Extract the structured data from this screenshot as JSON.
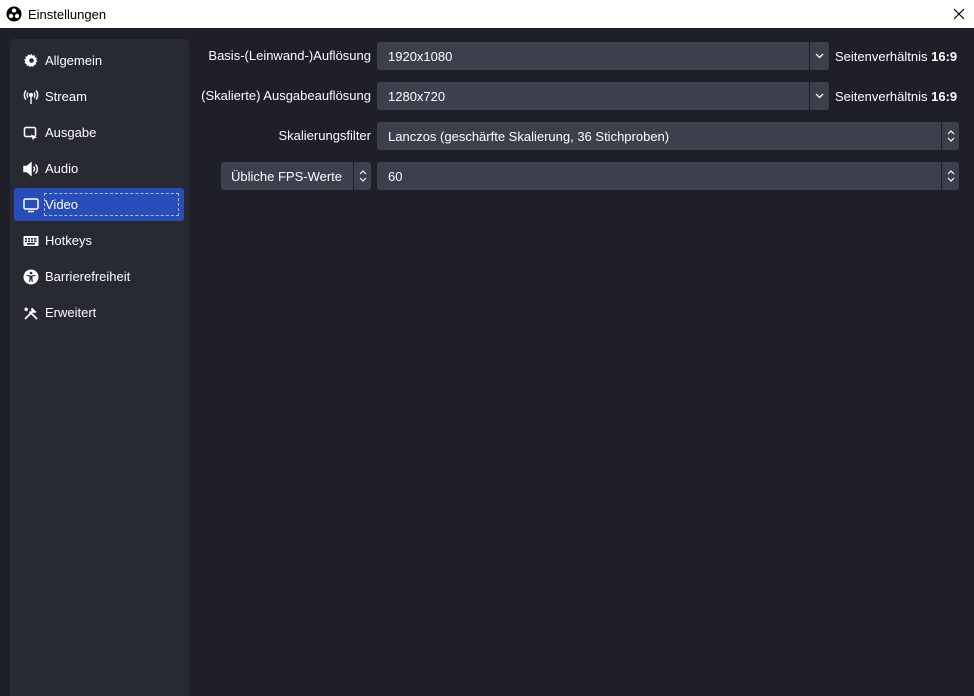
{
  "window": {
    "title": "Einstellungen"
  },
  "sidebar": {
    "items": [
      {
        "label": "Allgemein",
        "icon": "gear-icon"
      },
      {
        "label": "Stream",
        "icon": "antenna-icon"
      },
      {
        "label": "Ausgabe",
        "icon": "output-icon"
      },
      {
        "label": "Audio",
        "icon": "speaker-icon"
      },
      {
        "label": "Video",
        "icon": "monitor-icon",
        "active": true
      },
      {
        "label": "Hotkeys",
        "icon": "keyboard-icon"
      },
      {
        "label": "Barrierefreiheit",
        "icon": "accessibility-icon"
      },
      {
        "label": "Erweitert",
        "icon": "tools-icon"
      }
    ]
  },
  "video": {
    "base_resolution": {
      "label": "Basis-(Leinwand-)Auflösung",
      "value": "1920x1080",
      "aspect_prefix": "Seitenverhältnis",
      "aspect_value": "16:9"
    },
    "output_resolution": {
      "label": "(Skalierte) Ausgabeauflösung",
      "value": "1280x720",
      "aspect_prefix": "Seitenverhältnis",
      "aspect_value": "16:9"
    },
    "scale_filter": {
      "label": "Skalierungsfilter",
      "value": "Lanczos (geschärfte Skalierung, 36 Stichproben)"
    },
    "fps": {
      "type_value": "Übliche FPS-Werte",
      "value": "60"
    }
  },
  "colors": {
    "background": "#1e1f29",
    "sidebar": "#272a33",
    "control": "#3c404d",
    "accent": "#284cb8"
  }
}
